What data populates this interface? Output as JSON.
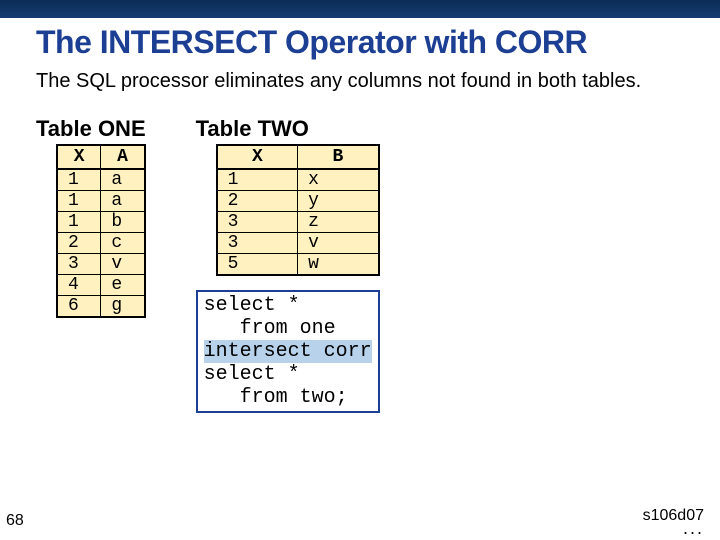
{
  "title": "The INTERSECT Operator with CORR",
  "subtitle": "The SQL processor eliminates any columns not found in both tables.",
  "tableOne": {
    "caption": "Table ONE",
    "headers": {
      "c1": "X",
      "c2": "A"
    },
    "rows": [
      {
        "c1": "1",
        "c2": "a"
      },
      {
        "c1": "1",
        "c2": "a"
      },
      {
        "c1": "1",
        "c2": "b"
      },
      {
        "c1": "2",
        "c2": "c"
      },
      {
        "c1": "3",
        "c2": "v"
      },
      {
        "c1": "4",
        "c2": "e"
      },
      {
        "c1": "6",
        "c2": "g"
      }
    ]
  },
  "tableTwo": {
    "caption": "Table TWO",
    "headers": {
      "c1": "X",
      "c2": "B"
    },
    "rows": [
      {
        "c1": "1",
        "c2": "x"
      },
      {
        "c1": "2",
        "c2": "y"
      },
      {
        "c1": "3",
        "c2": "z"
      },
      {
        "c1": "3",
        "c2": "v"
      },
      {
        "c1": "5",
        "c2": "w"
      }
    ]
  },
  "code": {
    "l1": "select *",
    "l2": "   from one",
    "l3": "intersect corr",
    "l4": "select *",
    "l5": "   from two;"
  },
  "pageNumber": "68",
  "footerRef": "s106d07",
  "footerDots": "..."
}
